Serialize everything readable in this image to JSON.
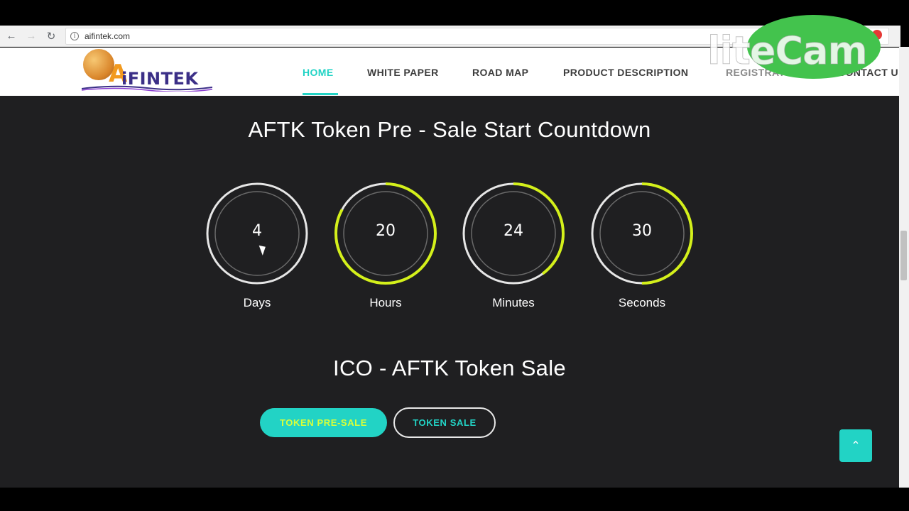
{
  "browser": {
    "url": "aifintek.com",
    "back_icon": "arrow-left-icon",
    "forward_icon": "arrow-right-icon",
    "reload_icon": "reload-icon"
  },
  "watermark": "liteCam",
  "header": {
    "logo_text": "AiFINTEK",
    "nav": [
      "HOME",
      "WHITE PAPER",
      "ROAD MAP",
      "PRODUCT DESCRIPTION",
      "REGISTRATION",
      "CONTACT U"
    ],
    "active": "HOME"
  },
  "countdown": {
    "title": "AFTK Token Pre - Sale Start Countdown",
    "units": [
      {
        "value": "4",
        "label": "Days",
        "progress": 0.0
      },
      {
        "value": "20",
        "label": "Hours",
        "progress": 0.83
      },
      {
        "value": "24",
        "label": "Minutes",
        "progress": 0.4
      },
      {
        "value": "30",
        "label": "Seconds",
        "progress": 0.5
      }
    ]
  },
  "sale": {
    "title": "ICO - AFTK Token Sale",
    "presale_label": "TOKEN PRE-SALE",
    "sale_label": "TOKEN SALE"
  },
  "back_to_top_icon": "chevron-up-icon",
  "colors": {
    "accent": "#22d3c5",
    "ring_progress": "#d4f01b",
    "background": "#1f1f21"
  }
}
